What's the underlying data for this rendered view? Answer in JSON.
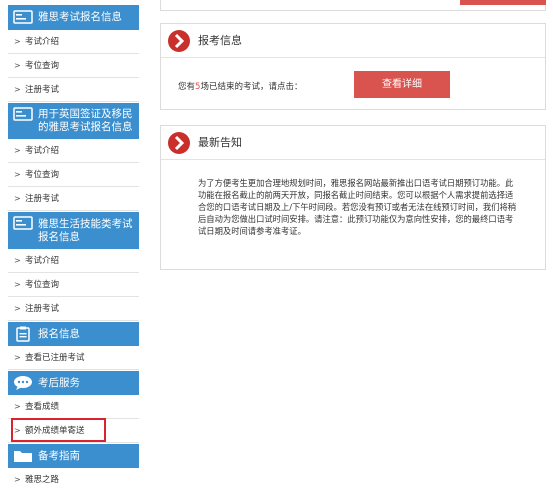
{
  "sidebar": {
    "sections": [
      {
        "title": "雅思考试报名信息",
        "icon": "id-card-icon",
        "items": [
          "考试介绍",
          "考位查询",
          "注册考试"
        ]
      },
      {
        "title": "用于英国签证及移民的雅思考试报名信息",
        "icon": "id-card-icon",
        "items": [
          "考试介绍",
          "考位查询",
          "注册考试"
        ]
      },
      {
        "title": "雅思生活技能类考试报名信息",
        "icon": "id-card-icon",
        "items": [
          "考试介绍",
          "考位查询",
          "注册考试"
        ]
      },
      {
        "title": "报名信息",
        "icon": "clipboard-icon",
        "items": [
          "查看已注册考试"
        ]
      },
      {
        "title": "考后服务",
        "icon": "chat-bubble-icon",
        "items": [
          "查看成绩",
          "额外成绩单寄送"
        ]
      },
      {
        "title": "备考指南",
        "icon": "folder-icon",
        "items": [
          "雅思之路"
        ]
      }
    ]
  },
  "registration_panel": {
    "title": "报考信息",
    "text_prefix": "您有",
    "count": "5",
    "text_suffix": "场已结束的考试，请点击：",
    "button_label": "查看详细"
  },
  "news_panel": {
    "title": "最新告知",
    "body": "为了方便考生更加合理地规划时间，雅思报名网站最新推出口语考试日期预订功能。此功能在报名截止的前两天开放，同报名截止时间结束。您可以根据个人需求提前选择适合您的口语考试日期及上/下午时间段。若您没有预订或者无法在线预订时间，我们将稍后自动为您做出口试时间安排。请注意：此预订功能仅为意向性安排，您的最终口语考试日期及时间请参考准考证。"
  },
  "colors": {
    "sidebar_header": "#3c8fce",
    "accent_red": "#d9534f",
    "highlight_border": "#d9232e",
    "count_color": "#d9534f"
  }
}
